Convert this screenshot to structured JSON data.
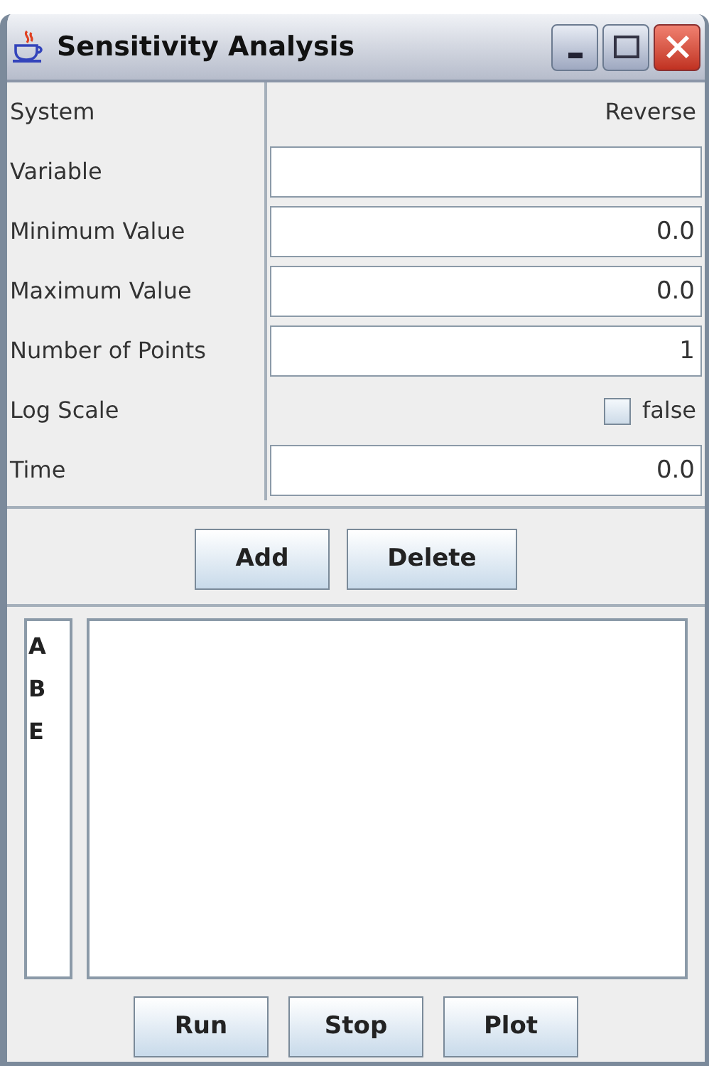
{
  "window": {
    "title": "Sensitivity Analysis"
  },
  "properties": [
    {
      "label": "System",
      "kind": "text",
      "value": "Reverse"
    },
    {
      "label": "Variable",
      "kind": "field"
    },
    {
      "label": "Minimum Value",
      "kind": "field",
      "value": "0.0"
    },
    {
      "label": "Maximum Value",
      "kind": "field",
      "value": "0.0"
    },
    {
      "label": "Number of Points",
      "kind": "field",
      "value": "1"
    },
    {
      "label": "Log Scale",
      "kind": "checkbox",
      "checked": false,
      "value": "false"
    },
    {
      "label": "Time",
      "kind": "field",
      "value": "0.0"
    }
  ],
  "edit_buttons": [
    "Add",
    "Delete"
  ],
  "variables": [
    "A",
    "B",
    "E"
  ],
  "run_buttons": [
    "Run",
    "Stop",
    "Plot"
  ]
}
